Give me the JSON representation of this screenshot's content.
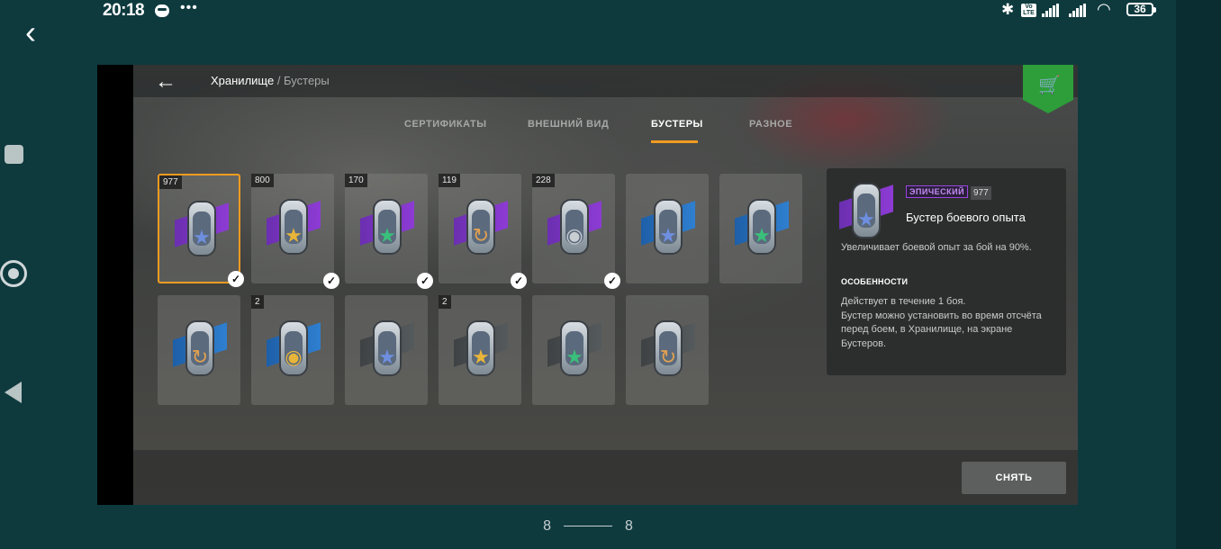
{
  "status_bar": {
    "time": "20:18",
    "dots": "•••",
    "battery": "36"
  },
  "breadcrumb": {
    "parent": "Хранилище",
    "separator": " / ",
    "current": "Бустеры"
  },
  "tabs": [
    {
      "label": "СЕРТИФИКАТЫ"
    },
    {
      "label": "ВНЕШНИЙ ВИД"
    },
    {
      "label": "БУСТЕРЫ",
      "active": true
    },
    {
      "label": "РАЗНОЕ"
    }
  ],
  "boosters": [
    {
      "count": "977",
      "ribbon": "purple",
      "emblem": "star",
      "color": "#6e8fe0",
      "selected": true,
      "installed": true
    },
    {
      "count": "800",
      "ribbon": "purple",
      "emblem": "star",
      "color": "#e8b53a",
      "installed": true
    },
    {
      "count": "170",
      "ribbon": "purple",
      "emblem": "star",
      "color": "#39c07a",
      "installed": true
    },
    {
      "count": "119",
      "ribbon": "purple",
      "emblem": "cycle",
      "color": "#e0a050",
      "installed": true
    },
    {
      "count": "228",
      "ribbon": "purple",
      "emblem": "coins",
      "color": "#c9ced3",
      "installed": true
    },
    {
      "count": "",
      "ribbon": "blue",
      "emblem": "star",
      "color": "#6e8fe0"
    },
    {
      "count": "",
      "ribbon": "blue",
      "emblem": "star",
      "color": "#39c07a"
    },
    {
      "count": "",
      "ribbon": "blue",
      "emblem": "cycle",
      "color": "#e0a050"
    },
    {
      "count": "2",
      "ribbon": "blue",
      "emblem": "coins",
      "color": "#e8b53a"
    },
    {
      "count": "",
      "ribbon": "gray",
      "emblem": "star",
      "color": "#6e8fe0"
    },
    {
      "count": "2",
      "ribbon": "gray",
      "emblem": "star",
      "color": "#e8b53a"
    },
    {
      "count": "",
      "ribbon": "gray",
      "emblem": "star",
      "color": "#39c07a"
    },
    {
      "count": "",
      "ribbon": "gray",
      "emblem": "cycle",
      "color": "#e0a050"
    }
  ],
  "info_panel": {
    "rarity": "ЭПИЧЕСКИЙ",
    "count": "977",
    "name": "Бустер боевого опыта",
    "description": "Увеличивает боевой опыт за бой на 90%.",
    "features_heading": "ОСОБЕННОСТИ",
    "features_text_1": "Действует в течение 1 боя.",
    "features_text_2": "Бустер можно установить во время отсчёта перед боем, в Хранилище, на экране Бустеров."
  },
  "remove_button": "СНЯТЬ",
  "pager": {
    "left": "8",
    "right": "8"
  }
}
